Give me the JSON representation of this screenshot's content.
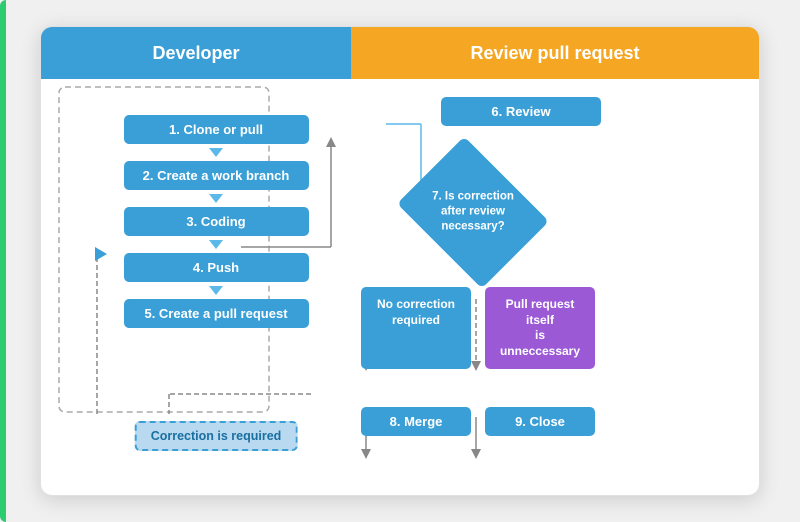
{
  "header": {
    "developer_label": "Developer",
    "review_label": "Review pull request"
  },
  "steps": {
    "step1": "1.  Clone or pull",
    "step2": "2.  Create a work branch",
    "step3": "3.  Coding",
    "step4": "4.  Push",
    "step5": "5.  Create a pull request",
    "step6": "6.  Review",
    "step7_label": "7.  Is correction\nafter review\nnecessary?",
    "step8": "8.  Merge",
    "step9": "9.  Close"
  },
  "outcomes": {
    "no_correction": "No correction\nrequired",
    "pull_unnecessary": "Pull request itself\nis unneccessary",
    "correction_required": "Correction is required"
  },
  "colors": {
    "blue": "#3a9fd6",
    "orange": "#f5a623",
    "purple": "#9b59d6",
    "light_blue": "#b8d9f0",
    "green": "#2ecc71"
  }
}
